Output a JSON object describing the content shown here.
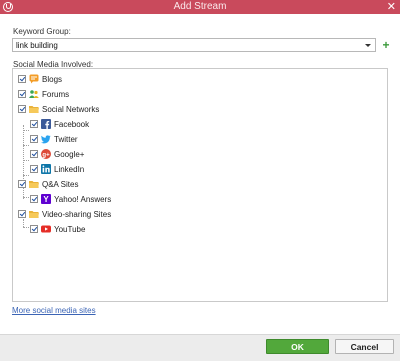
{
  "window": {
    "title": "Add Stream"
  },
  "keyword_group": {
    "label": "Keyword Group:",
    "selected": "link building"
  },
  "social_media": {
    "label": "Social Media Involved:",
    "items": [
      {
        "label": "Blogs",
        "icon": "blog-icon",
        "checked": true,
        "level": 0
      },
      {
        "label": "Forums",
        "icon": "forum-icon",
        "checked": true,
        "level": 0
      },
      {
        "label": "Social Networks",
        "icon": "folder-icon",
        "checked": true,
        "level": 0
      },
      {
        "label": "Facebook",
        "icon": "facebook-icon",
        "checked": true,
        "level": 1
      },
      {
        "label": "Twitter",
        "icon": "twitter-icon",
        "checked": true,
        "level": 1
      },
      {
        "label": "Google+",
        "icon": "google-plus-icon",
        "checked": true,
        "level": 1
      },
      {
        "label": "LinkedIn",
        "icon": "linkedin-icon",
        "checked": true,
        "level": 1
      },
      {
        "label": "Q&A Sites",
        "icon": "folder-icon",
        "checked": true,
        "level": 0
      },
      {
        "label": "Yahoo! Answers",
        "icon": "yahoo-icon",
        "checked": true,
        "level": 1
      },
      {
        "label": "Video-sharing Sites",
        "icon": "folder-icon",
        "checked": true,
        "level": 0
      },
      {
        "label": "YouTube",
        "icon": "youtube-icon",
        "checked": true,
        "level": 1
      }
    ]
  },
  "links": {
    "more": "More social media sites"
  },
  "buttons": {
    "ok": "OK",
    "cancel": "Cancel"
  },
  "colors": {
    "titlebar": "#c94a5c",
    "ok": "#52a83b",
    "link": "#3b64b5"
  }
}
